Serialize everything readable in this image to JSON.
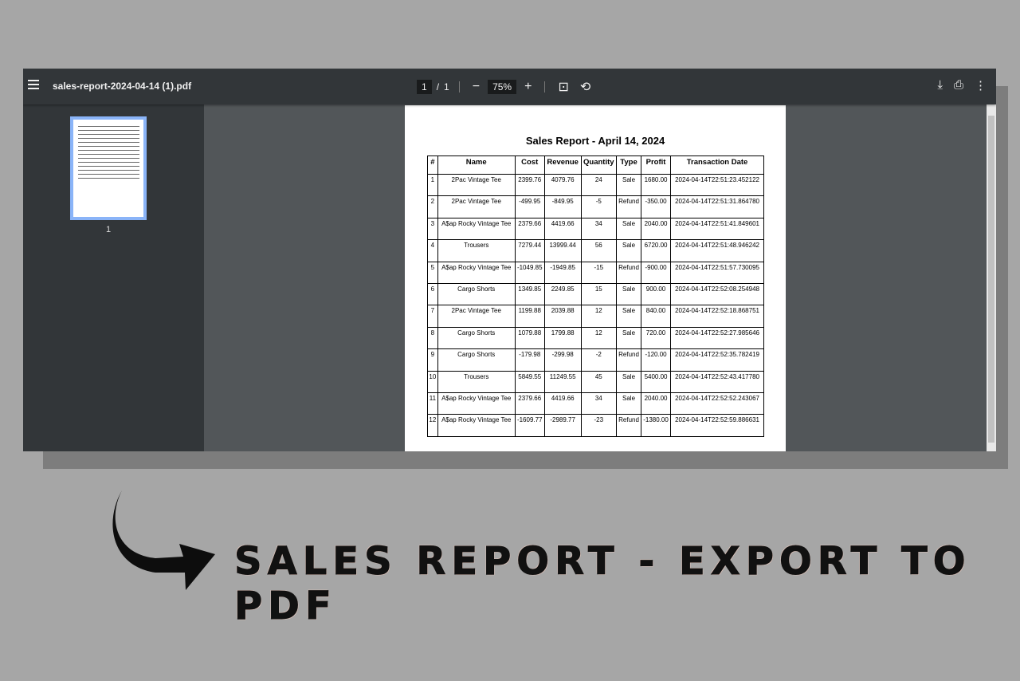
{
  "toolbar": {
    "title": "sales-report-2024-04-14 (1).pdf",
    "page_current": "1",
    "page_sep": "/",
    "page_total": "1",
    "zoom": "75%",
    "icons": [
      "menu-icon",
      "zoom-out-icon",
      "zoom-in-icon",
      "fit-page-icon",
      "rotate-icon",
      "download-icon",
      "print-icon",
      "more-icon"
    ]
  },
  "sidebar": {
    "thumbnail_label": "1"
  },
  "document": {
    "title": "Sales Report - April 14, 2024",
    "columns": [
      "#",
      "Name",
      "Cost",
      "Revenue",
      "Quantity",
      "Type",
      "Profit",
      "Transaction Date"
    ],
    "rows": [
      [
        "1",
        "2Pac Vintage Tee",
        "2399.76",
        "4079.76",
        "24",
        "Sale",
        "1680.00",
        "2024-04-14T22:51:23.452122"
      ],
      [
        "2",
        "2Pac Vintage Tee",
        "-499.95",
        "-849.95",
        "-5",
        "Refund",
        "-350.00",
        "2024-04-14T22:51:31.864780"
      ],
      [
        "3",
        "A$ap Rocky Vintage Tee",
        "2379.66",
        "4419.66",
        "34",
        "Sale",
        "2040.00",
        "2024-04-14T22:51:41.849601"
      ],
      [
        "4",
        "Trousers",
        "7279.44",
        "13999.44",
        "56",
        "Sale",
        "6720.00",
        "2024-04-14T22:51:48.946242"
      ],
      [
        "5",
        "A$ap Rocky Vintage Tee",
        "-1049.85",
        "-1949.85",
        "-15",
        "Refund",
        "-900.00",
        "2024-04-14T22:51:57.730095"
      ],
      [
        "6",
        "Cargo Shorts",
        "1349.85",
        "2249.85",
        "15",
        "Sale",
        "900.00",
        "2024-04-14T22:52:08.254948"
      ],
      [
        "7",
        "2Pac Vintage Tee",
        "1199.88",
        "2039.88",
        "12",
        "Sale",
        "840.00",
        "2024-04-14T22:52:18.868751"
      ],
      [
        "8",
        "Cargo Shorts",
        "1079.88",
        "1799.88",
        "12",
        "Sale",
        "720.00",
        "2024-04-14T22:52:27.985646"
      ],
      [
        "9",
        "Cargo Shorts",
        "-179.98",
        "-299.98",
        "-2",
        "Refund",
        "-120.00",
        "2024-04-14T22:52:35.782419"
      ],
      [
        "10",
        "Trousers",
        "5849.55",
        "11249.55",
        "45",
        "Sale",
        "5400.00",
        "2024-04-14T22:52:43.417780"
      ],
      [
        "11",
        "A$ap Rocky Vintage Tee",
        "2379.66",
        "4419.66",
        "34",
        "Sale",
        "2040.00",
        "2024-04-14T22:52:52.243067"
      ],
      [
        "12",
        "A$ap Rocky Vintage Tee",
        "-1609.77",
        "-2989.77",
        "-23",
        "Refund",
        "-1380.00",
        "2024-04-14T22:52:59.886631"
      ]
    ]
  },
  "caption": "SALES REPORT - EXPORT TO PDF",
  "colors": {
    "toolbar": "#323639",
    "viewer_bg": "#525659",
    "thumb_border": "#8ab4f8",
    "page_bg": "#a6a6a6"
  }
}
